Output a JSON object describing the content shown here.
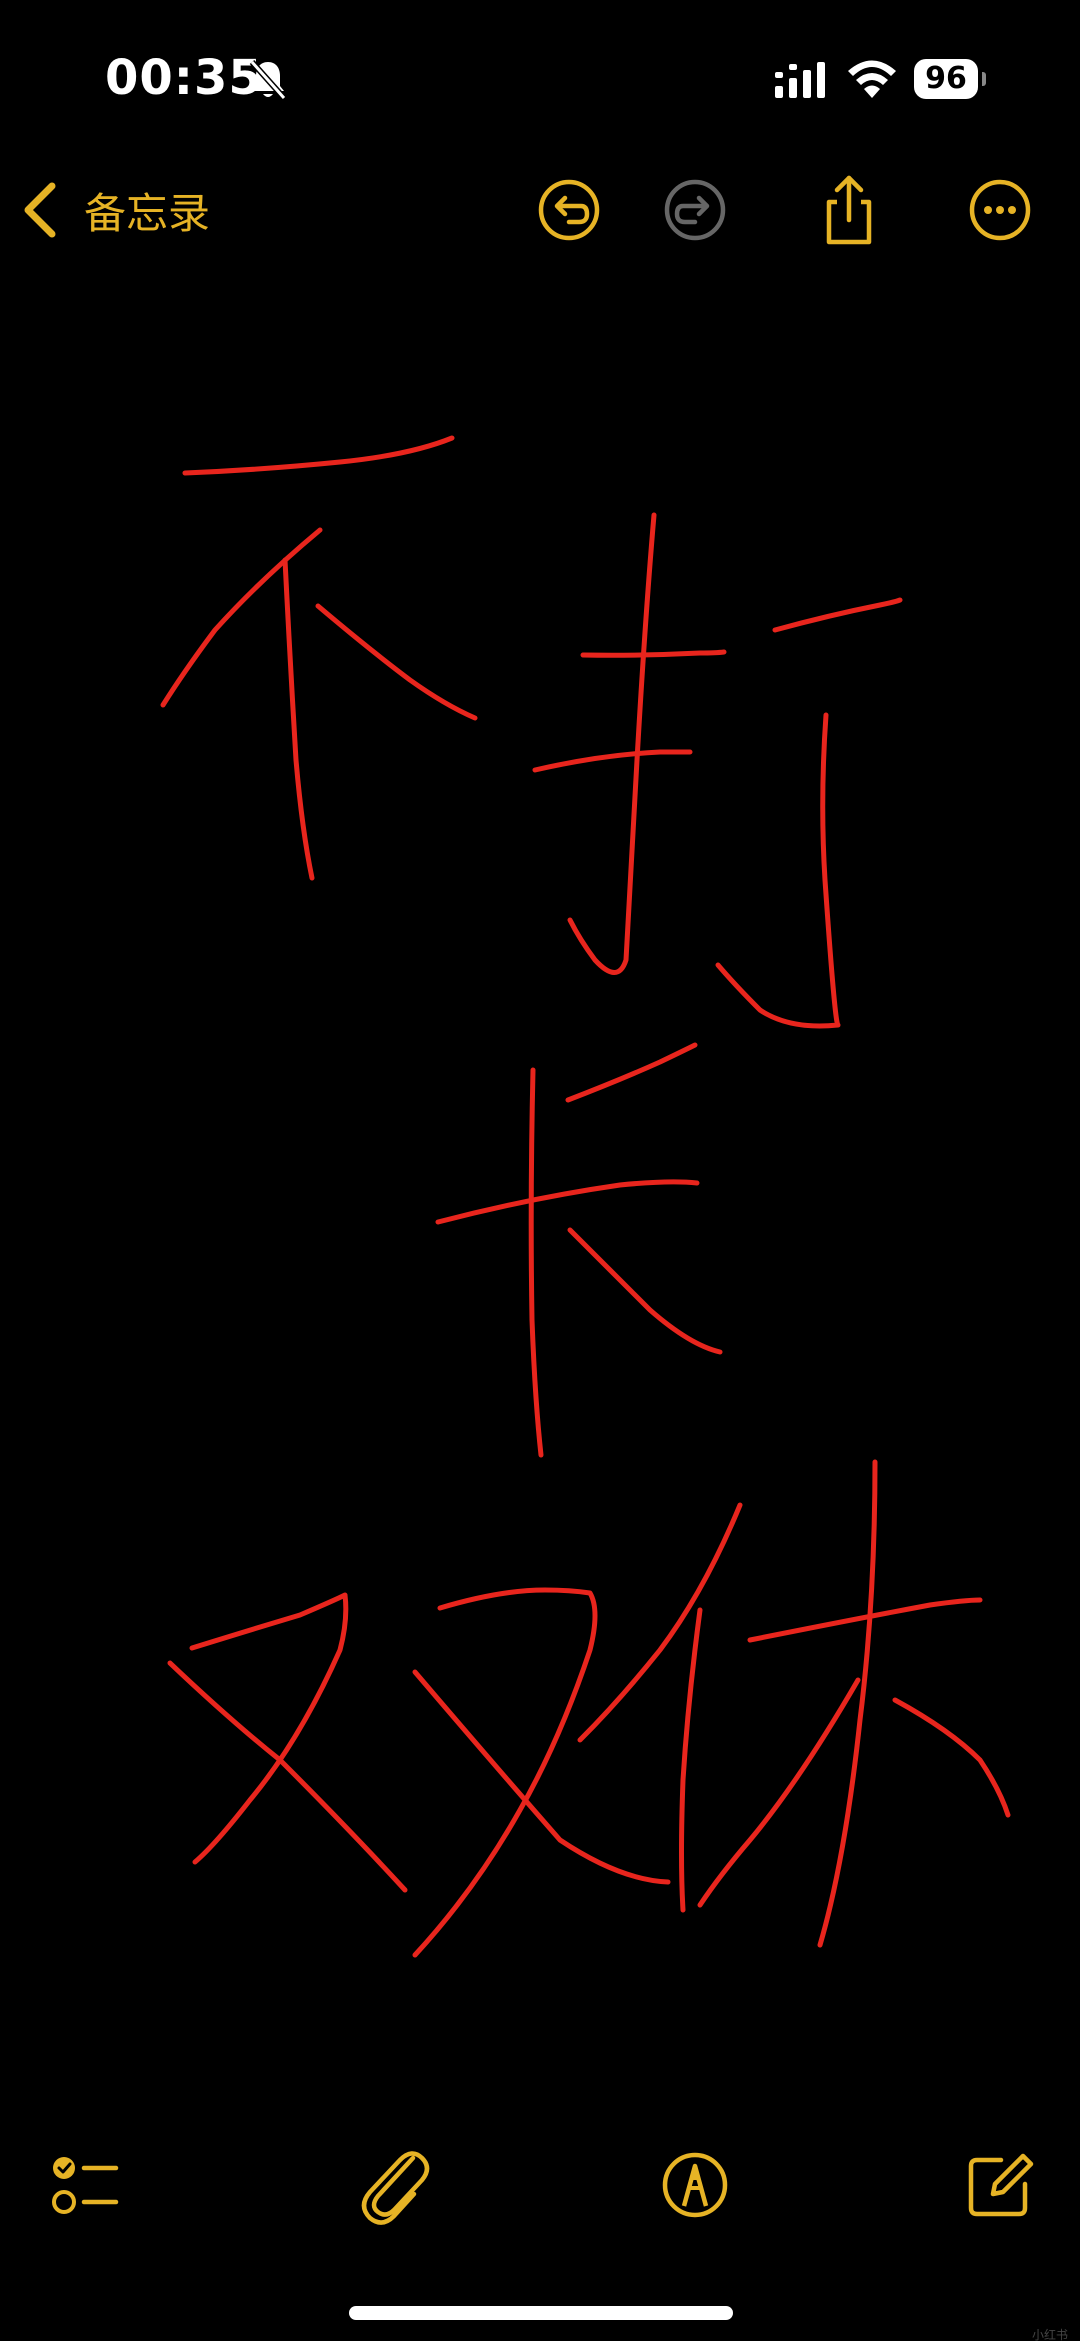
{
  "status_bar": {
    "time": "00:35",
    "battery": "96",
    "icons": [
      "bell-slash-icon",
      "signal-icon",
      "wifi-icon",
      "battery-icon"
    ]
  },
  "nav_bar": {
    "back_label": "备忘录",
    "icons": [
      "undo-icon",
      "redo-icon",
      "share-icon",
      "more-icon"
    ]
  },
  "drawing": {
    "description_strokes_color": "#e8251d",
    "handwritten_text_lines": [
      "不",
      "打",
      "卡",
      "双休"
    ]
  },
  "bottom_toolbar": {
    "icons": [
      "checklist-icon",
      "attachment-icon",
      "markup-icon",
      "compose-icon"
    ]
  },
  "colors": {
    "accent": "#e6b325",
    "background": "#000000",
    "ink": "#e8251d",
    "disabled": "#666666"
  },
  "watermark": "小红书"
}
